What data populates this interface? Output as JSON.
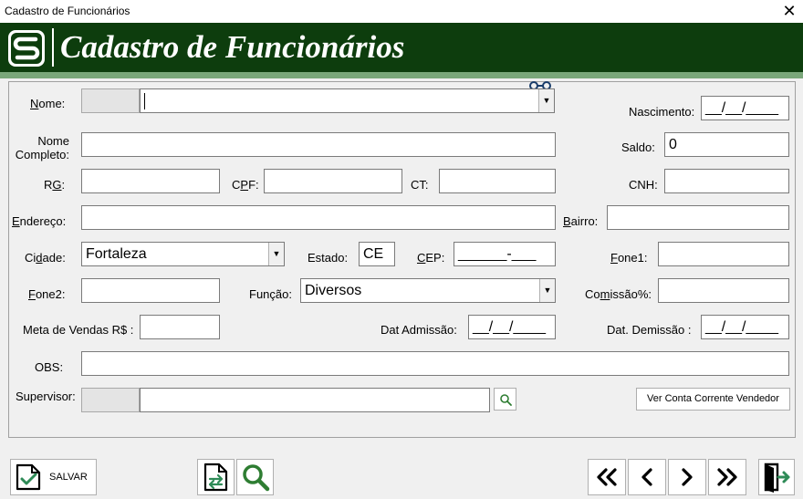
{
  "window": {
    "title": "Cadastro de Funcionários",
    "close": "✕"
  },
  "header": {
    "title": "Cadastro de Funcionários"
  },
  "form": {
    "nome": {
      "label_first": "N",
      "label_rest": "ome:",
      "value": ""
    },
    "nascimento": {
      "label": "Nascimento:",
      "value": "__/__/____"
    },
    "nome_completo": {
      "label_line1": "Nome",
      "label_line2": "Completo:",
      "value": ""
    },
    "saldo": {
      "label": "Saldo:",
      "value": "0"
    },
    "rg": {
      "label_a": "R",
      "label_b": "G",
      "label_c": ":",
      "value": ""
    },
    "cpf": {
      "label_a": "C",
      "label_b": "P",
      "label_c": "F:",
      "value": ""
    },
    "ct": {
      "label": "CT:",
      "value": ""
    },
    "cnh": {
      "label": "CNH:",
      "value": ""
    },
    "endereco": {
      "label_first": "E",
      "label_rest": "ndereço:",
      "value": ""
    },
    "bairro": {
      "label_first": "B",
      "label_rest": "airro:",
      "value": ""
    },
    "cidade": {
      "label_a": "Ci",
      "label_b": "d",
      "label_c": "ade:",
      "value": "Fortaleza"
    },
    "estado": {
      "label": "Estado:",
      "value": "CE"
    },
    "cep": {
      "label_first": "C",
      "label_rest": "EP:",
      "value": "______-___"
    },
    "fone1": {
      "label_first": "F",
      "label_rest": "one1:",
      "value": ""
    },
    "fone2": {
      "label_first": "F",
      "label_rest": "one2:",
      "value": ""
    },
    "funcao": {
      "label": "Função:",
      "value": "Diversos"
    },
    "comissao": {
      "label_a": "Co",
      "label_b": "m",
      "label_c": "issão%:",
      "value": ""
    },
    "meta": {
      "label": "Meta de Vendas R$ :",
      "value": ""
    },
    "admissao": {
      "label": "Dat Admissão:",
      "value": "__/__/____"
    },
    "demissao": {
      "label": "Dat. Demissão :",
      "value": "__/__/____"
    },
    "obs": {
      "label": "OBS:",
      "value": ""
    },
    "supervisor": {
      "label": "Supervisor:",
      "value": ""
    },
    "ver_conta": "Ver Conta Corrente Vendedor"
  },
  "toolbar": {
    "save_label": "SALVAR"
  },
  "colors": {
    "header_bg": "#0d3d0d",
    "stripe": "#7aa77a",
    "accent_green": "#2e7d32"
  }
}
